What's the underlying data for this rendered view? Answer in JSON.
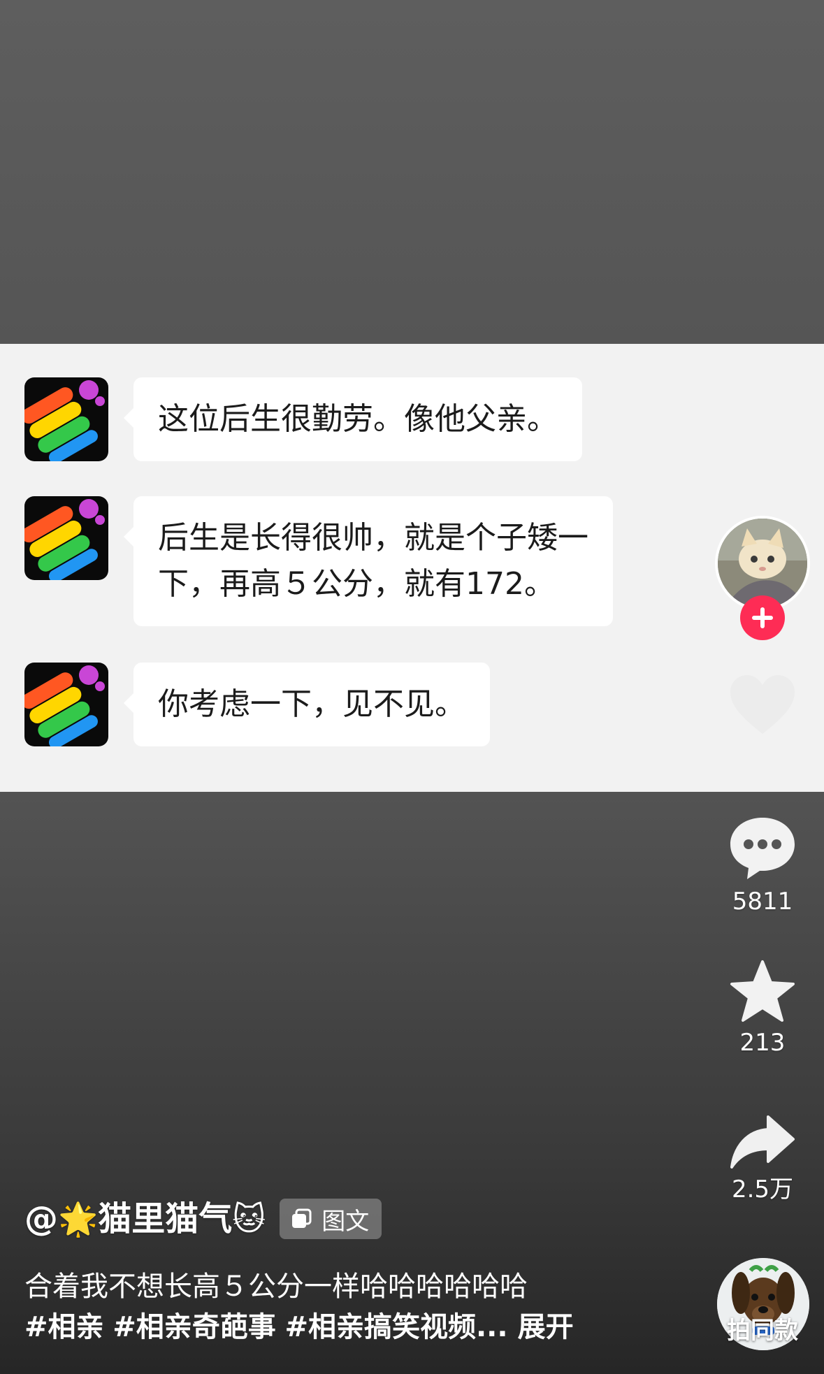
{
  "chat": {
    "messages": [
      {
        "lines": [
          "这位后生很勤劳。像他父亲。"
        ]
      },
      {
        "lines": [
          "后生是长得很帅，就是个子矮一",
          "下，再高５公分，就有172。"
        ]
      },
      {
        "lines": [
          "你考虑一下，见不见。"
        ]
      }
    ]
  },
  "actions": {
    "like_count": "",
    "comment_count": "5811",
    "favorite_count": "213",
    "share_count": "2.5万"
  },
  "post": {
    "author_prefix": "@",
    "author_emoji_left": "🌟",
    "author_name": "猫里猫气",
    "author_emoji_right": "🐱",
    "type_tag": "图文",
    "caption_text": "合着我不想长高５公分一样哈哈哈哈哈哈",
    "hashtags": [
      "#相亲",
      "#相亲奇葩事",
      "#相亲搞笑视频..."
    ],
    "expand_label": "展开"
  },
  "music": {
    "same_style_label": "拍同款"
  },
  "icons": {
    "chat_avatar": "rainbow-app-icon",
    "follow": "plus-icon",
    "like": "heart-icon",
    "comment": "comment-dots-icon",
    "favorite": "star-icon",
    "share": "share-arrow-icon",
    "type_tag": "image-stack-icon"
  },
  "colors": {
    "follow_red": "#fe2c55",
    "chat_bg": "#f2f2f2",
    "bubble_bg": "#ffffff"
  }
}
